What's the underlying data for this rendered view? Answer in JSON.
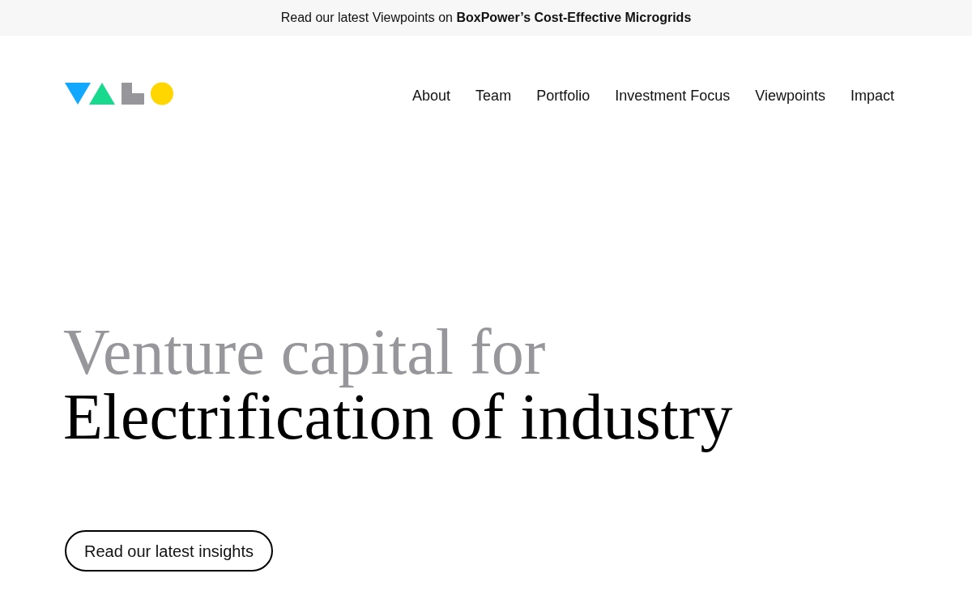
{
  "announcement_bar": {
    "text": "Read our latest Viewpoints on **BoxPower’s Cost-Effective Microgrids**"
  },
  "nav": {
    "items": [
      "About",
      "Team",
      "Portfolio",
      "Investment Focus",
      "Viewpoints",
      "Impact"
    ]
  },
  "hero": {
    "headline_lines": [
      {
        "text": "Venture capital for",
        "kind": "muted"
      },
      {
        "text": "Electrification of industry",
        "kind": "strong"
      }
    ],
    "button": {
      "label": "Read our latest insights"
    }
  }
}
